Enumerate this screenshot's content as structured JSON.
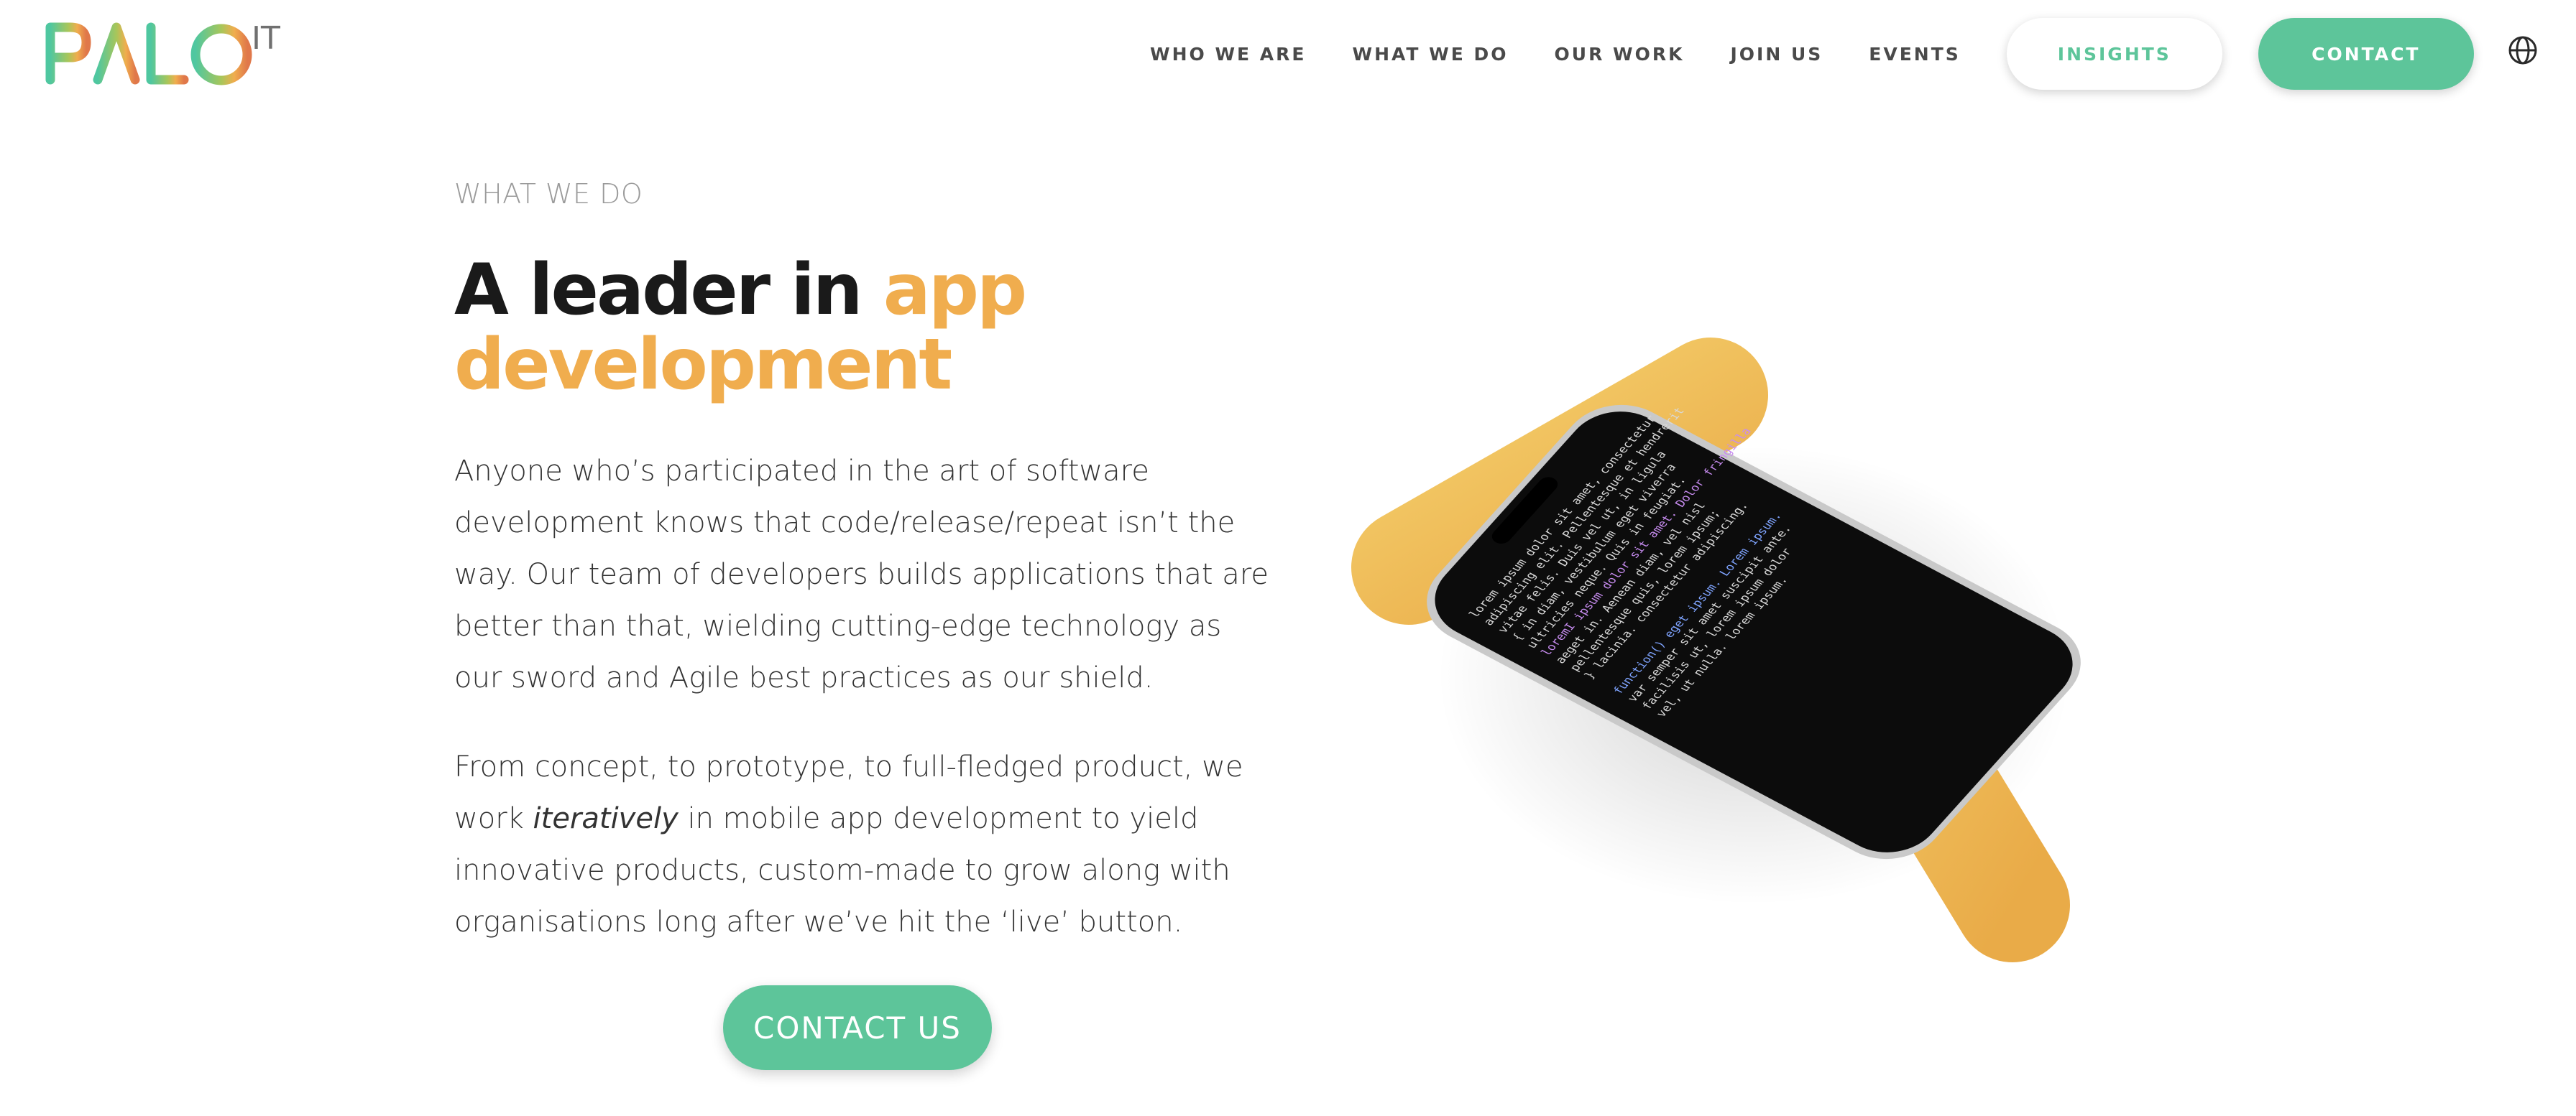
{
  "brand": {
    "name": "PALO IT",
    "logo_main": "PALO",
    "logo_sup": "IT"
  },
  "nav": {
    "items": [
      {
        "label": "WHO WE ARE",
        "name": "nav-who-we-are"
      },
      {
        "label": "WHAT WE DO",
        "name": "nav-what-we-do"
      },
      {
        "label": "OUR WORK",
        "name": "nav-our-work"
      },
      {
        "label": "JOIN US",
        "name": "nav-join-us"
      },
      {
        "label": "EVENTS",
        "name": "nav-events"
      }
    ],
    "insights_label": "INSIGHTS",
    "contact_label": "CONTACT",
    "language_icon": "globe-icon"
  },
  "hero": {
    "eyebrow": "WHAT WE DO",
    "headline_plain": "A leader in ",
    "headline_accent_1": "app",
    "headline_accent_2": "development",
    "para1": "Anyone who’s participated in the art of software development knows that code/release/repeat isn’t the way. Our team of developers builds applications that are better than that, wielding cutting-edge technology as our sword and Agile best practices as our shield.",
    "para2_a": "From concept, to prototype, to full-fledged product, we work ",
    "para2_em": "iteratively",
    "para2_b": " in mobile app development to yield innovative products, custom-made to grow along with organisations long after we’ve hit the ‘live’ button.",
    "cta_label": "CONTACT US"
  },
  "colors": {
    "accent_green": "#5dc59a",
    "accent_orange": "#f0ad4e",
    "text_dark": "#1a1a1a",
    "text_muted": "#9a9a9a"
  },
  "illustration": {
    "phone_code_lines": [
      "lorem ipsum dolor sit amet, consectetur",
      "adipiscing elit. Pellentesque et hendrerit",
      "vitae felis. Duis vel ut, in ligula",
      "{ in diam, vestibulum eget viverra",
      "  ultricies neque. Quis in feugiat.",
      "loremI ipsum dolor sit amet. Dolor fringilla",
      "  aeget in. Aenean diam, vel nisl",
      "  pellentesque quis, lorem ipsum;",
      "} lacinia. consectetur adipiscing.",
      "",
      "function() eget ipsum. Lorem ipsum.",
      "  var semper sit amet suscipit ante.",
      "  facilisis ut, lorem ipsum dolor",
      "  vel, ut nulla. lorem ipsum."
    ]
  }
}
